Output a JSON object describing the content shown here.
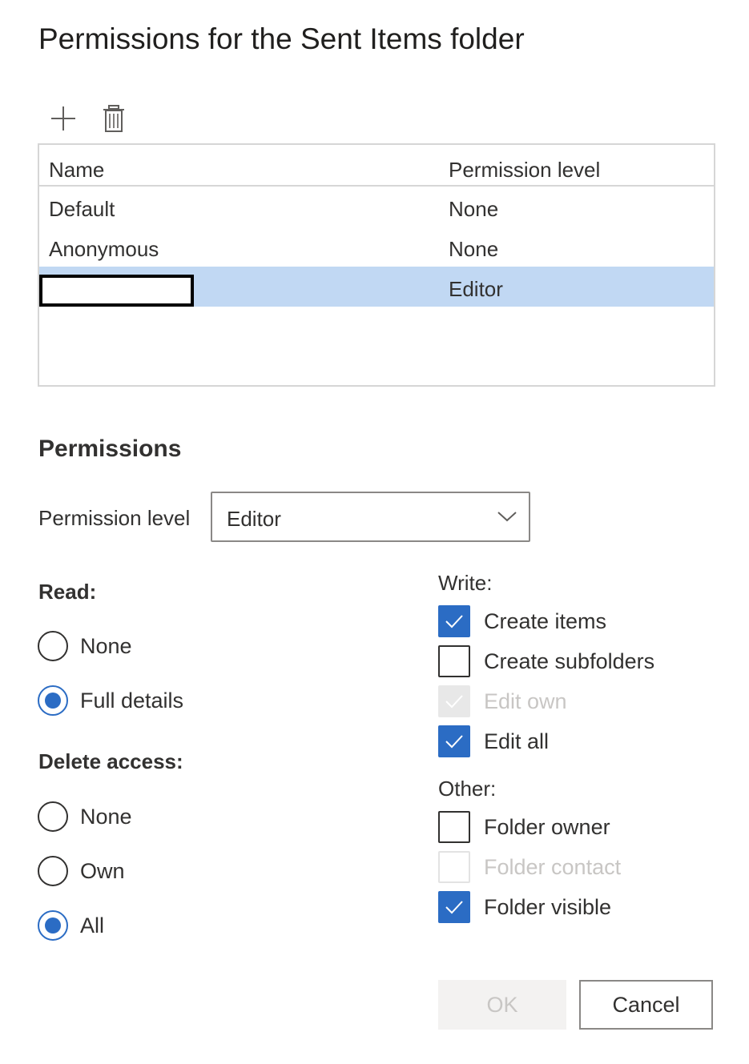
{
  "dialog": {
    "title": "Permissions for the Sent Items folder"
  },
  "toolbar": {
    "add_icon": "plus-icon",
    "delete_icon": "trash-icon"
  },
  "table": {
    "columns": {
      "name": "Name",
      "level": "Permission level"
    },
    "rows": [
      {
        "name": "Default",
        "level": "None",
        "selected": false
      },
      {
        "name": "Anonymous",
        "level": "None",
        "selected": false
      },
      {
        "name": "",
        "level": "Editor",
        "selected": true,
        "name_redacted": true
      }
    ]
  },
  "permissions": {
    "heading": "Permissions",
    "level_label": "Permission level",
    "level_value": "Editor",
    "read": {
      "label": "Read:",
      "options": [
        {
          "label": "None",
          "checked": false
        },
        {
          "label": "Full details",
          "checked": true
        }
      ]
    },
    "delete": {
      "label": "Delete access:",
      "options": [
        {
          "label": "None",
          "checked": false
        },
        {
          "label": "Own",
          "checked": false
        },
        {
          "label": "All",
          "checked": true
        }
      ]
    },
    "write": {
      "label": "Write:",
      "options": [
        {
          "label": "Create items",
          "checked": true,
          "disabled": false
        },
        {
          "label": "Create subfolders",
          "checked": false,
          "disabled": false
        },
        {
          "label": "Edit own",
          "checked": true,
          "disabled": true
        },
        {
          "label": "Edit all",
          "checked": true,
          "disabled": false
        }
      ]
    },
    "other": {
      "label": "Other:",
      "options": [
        {
          "label": "Folder owner",
          "checked": false,
          "disabled": false
        },
        {
          "label": "Folder contact",
          "checked": false,
          "disabled": true
        },
        {
          "label": "Folder visible",
          "checked": true,
          "disabled": false
        }
      ]
    }
  },
  "buttons": {
    "ok": "OK",
    "cancel": "Cancel",
    "ok_disabled": true
  },
  "colors": {
    "accent": "#2b6cc4",
    "selected_row": "#c1d8f3",
    "disabled_text": "#c8c6c4"
  }
}
